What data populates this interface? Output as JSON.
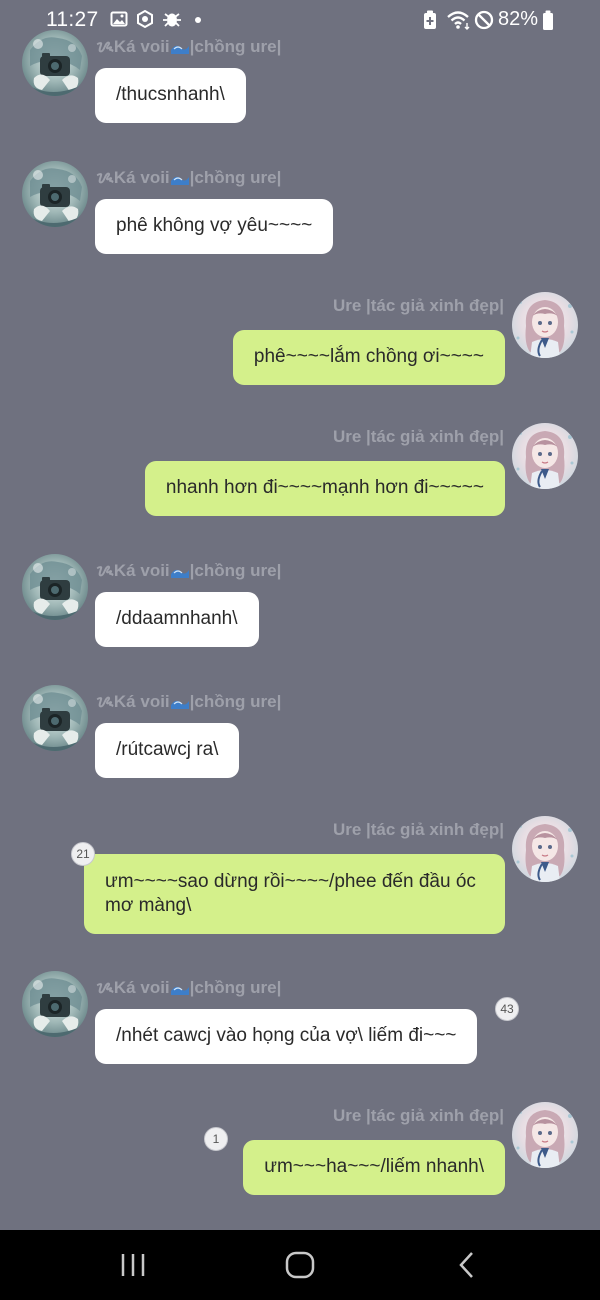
{
  "status_bar": {
    "time": "11:27",
    "battery": "82%",
    "left_icons": [
      "image-icon",
      "settings-hex-icon",
      "bug-icon",
      "dot-icon"
    ],
    "right_icons": [
      "battery-saver-icon",
      "wifi-icon",
      "do-not-disturb-icon",
      "battery-icon"
    ]
  },
  "users": {
    "husband": {
      "name_prefix": "ᝰ",
      "name_a": "Ká voii",
      "name_b": "|chồng ure|",
      "avatar_icon": "anime-avatar-camera-icon"
    },
    "wife": {
      "name": "Ure |tác giả xinh đẹp|",
      "avatar_icon": "anime-avatar-girl-icon"
    }
  },
  "messages": [
    {
      "text": "/thucsnhanh\\"
    },
    {
      "text": "phê không vợ yêu~~~~"
    },
    {
      "text": "phê~~~~lắm chồng ơi~~~~"
    },
    {
      "text": "nhanh hơn đi~~~~mạnh hơn đi~~~~~"
    },
    {
      "text": "/ddaamnhanh\\"
    },
    {
      "text": "/rútcawcj ra\\"
    },
    {
      "text": "ưm~~~~sao dừng rồi~~~~/phee đến đầu óc mơ màng\\",
      "badge": "21"
    },
    {
      "text": "/nhét cawcj vào họng của vợ\\ liếm đi~~~",
      "badge": "43"
    },
    {
      "text": "ưm~~~ha~~~/liếm nhanh\\",
      "badge": "1"
    }
  ],
  "colors": {
    "background": "#6f717f",
    "incoming_bubble": "#ffffff",
    "outgoing_bubble": "#d4f08b",
    "sender_name": "#9ea0aa",
    "nav_bar": "#000000"
  },
  "nav_bar": {
    "icons": [
      "recent-apps-icon",
      "home-icon",
      "back-icon"
    ]
  }
}
